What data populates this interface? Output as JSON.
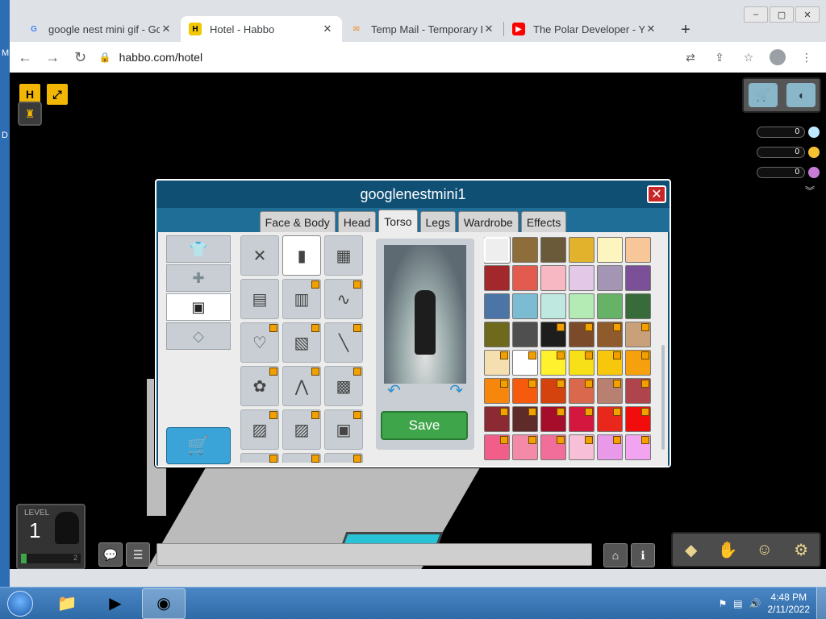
{
  "desktop": {
    "left_letters": [
      "M",
      "D"
    ]
  },
  "browser": {
    "window_controls": [
      "–",
      "▢",
      "✕"
    ],
    "tabs": [
      {
        "title": "google nest mini gif - Goo",
        "favicon": "G",
        "close": "✕"
      },
      {
        "title": "Hotel - Habbo",
        "favicon": "H",
        "close": "✕",
        "active": true
      },
      {
        "title": "Temp Mail - Temporary Di",
        "favicon": "✉",
        "close": "✕"
      },
      {
        "title": "The Polar Developer - You",
        "favicon": "▶",
        "close": "✕"
      }
    ],
    "new_tab": "+",
    "url": "habbo.com/hotel"
  },
  "hud": {
    "habbo_button": "H",
    "fullscreen_button": "⤢",
    "currencies": [
      {
        "name": "diamonds",
        "value": "0",
        "color": "#bfe9ff"
      },
      {
        "name": "credits",
        "value": "0",
        "color": "#f2c230"
      },
      {
        "name": "duckets",
        "value": "0",
        "color": "#c77dd8"
      }
    ],
    "level": {
      "label": "LEVEL",
      "number": "1",
      "progress": 0.1,
      "goal": "2"
    }
  },
  "editor": {
    "title": "googlenestmini1",
    "close": "✕",
    "tabs": [
      "Face & Body",
      "Head",
      "Torso",
      "Legs",
      "Wardrobe",
      "Effects"
    ],
    "active_tab": "Torso",
    "save_label": "Save",
    "categories": [
      "shirt",
      "jacket-plus",
      "jacket",
      "necklace"
    ],
    "active_category": 2,
    "palette": [
      {
        "color": "#eeeeee",
        "hc": false,
        "sel": true
      },
      {
        "color": "#8d6e3a",
        "hc": false
      },
      {
        "color": "#6b5a3a",
        "hc": false
      },
      {
        "color": "#e3b22c",
        "hc": false
      },
      {
        "color": "#fcf5c0",
        "hc": false
      },
      {
        "color": "#f7c79a",
        "hc": false
      },
      {
        "color": "#a3282c",
        "hc": false
      },
      {
        "color": "#e35a4f",
        "hc": false
      },
      {
        "color": "#f7b8c3",
        "hc": false
      },
      {
        "color": "#e3c8e8",
        "hc": false
      },
      {
        "color": "#a395b3",
        "hc": false
      },
      {
        "color": "#7c4f99",
        "hc": false
      },
      {
        "color": "#4a75a6",
        "hc": false
      },
      {
        "color": "#7bbcd3",
        "hc": false
      },
      {
        "color": "#bfe8e0",
        "hc": false
      },
      {
        "color": "#b4ebb4",
        "hc": false
      },
      {
        "color": "#66b266",
        "hc": false
      },
      {
        "color": "#386b3a",
        "hc": false
      },
      {
        "color": "#6d6a1e",
        "hc": false
      },
      {
        "color": "#4f4f4f",
        "hc": false
      },
      {
        "color": "#1d1d1d",
        "hc": true
      },
      {
        "color": "#7a4a2a",
        "hc": true
      },
      {
        "color": "#8f5a2c",
        "hc": true
      },
      {
        "color": "#c8a07a",
        "hc": true
      },
      {
        "color": "#f5dfb0",
        "hc": true
      },
      {
        "color": "#ffffff",
        "hc": true
      },
      {
        "color": "#fff12e",
        "hc": true
      },
      {
        "color": "#f7e017",
        "hc": true
      },
      {
        "color": "#f7c70d",
        "hc": true
      },
      {
        "color": "#f7a00d",
        "hc": true
      },
      {
        "color": "#f7860d",
        "hc": true
      },
      {
        "color": "#f55a0d",
        "hc": true
      },
      {
        "color": "#d4420d",
        "hc": true
      },
      {
        "color": "#d9684c",
        "hc": true
      },
      {
        "color": "#b88070",
        "hc": true
      },
      {
        "color": "#b0444d",
        "hc": true
      },
      {
        "color": "#8c2a33",
        "hc": true
      },
      {
        "color": "#5e2a2a",
        "hc": true
      },
      {
        "color": "#a60d2a",
        "hc": true
      },
      {
        "color": "#d4173e",
        "hc": true
      },
      {
        "color": "#e8281c",
        "hc": true
      },
      {
        "color": "#f20d0d",
        "hc": true
      },
      {
        "color": "#f25e8a",
        "hc": true
      },
      {
        "color": "#f28aa8",
        "hc": true
      },
      {
        "color": "#f26e9a",
        "hc": true
      },
      {
        "color": "#f7c0d8",
        "hc": true
      },
      {
        "color": "#e89ae8",
        "hc": true
      },
      {
        "color": "#f2a4f0",
        "hc": true
      }
    ],
    "items": [
      {
        "icon": "✕",
        "hc": false
      },
      {
        "icon": "▮",
        "hc": false,
        "sel": true
      },
      {
        "icon": "▦",
        "hc": false
      },
      {
        "icon": "▤",
        "hc": false
      },
      {
        "icon": "▥",
        "hc": true
      },
      {
        "icon": "∿",
        "hc": true
      },
      {
        "icon": "♡",
        "hc": true
      },
      {
        "icon": "▧",
        "hc": true
      },
      {
        "icon": "╲",
        "hc": true
      },
      {
        "icon": "✿",
        "hc": true
      },
      {
        "icon": "⋀",
        "hc": true
      },
      {
        "icon": "▩",
        "hc": true
      },
      {
        "icon": "▨",
        "hc": true
      },
      {
        "icon": "▨",
        "hc": true
      },
      {
        "icon": "▣",
        "hc": true
      },
      {
        "icon": "▫",
        "hc": true
      },
      {
        "icon": "▫",
        "hc": true
      },
      {
        "icon": "▫",
        "hc": true
      }
    ]
  },
  "taskbar": {
    "time": "4:48 PM",
    "date": "2/11/2022",
    "apps": [
      "folder",
      "media-player",
      "chrome"
    ]
  }
}
